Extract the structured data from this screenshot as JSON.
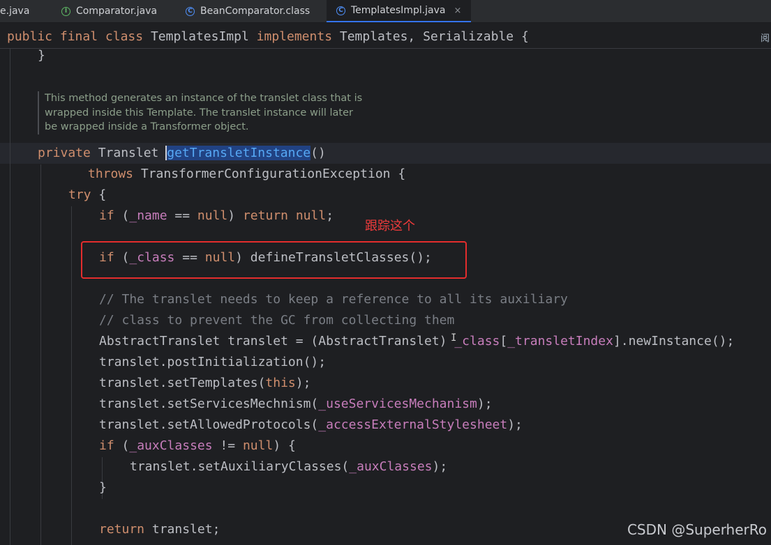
{
  "tabs": [
    {
      "label": "e.java",
      "icon": "none",
      "active": false
    },
    {
      "label": "Comparator.java",
      "icon": "interface-icon",
      "active": false
    },
    {
      "label": "BeanComparator.class",
      "icon": "class-icon",
      "active": false
    },
    {
      "label": "TemplatesImpl.java",
      "icon": "class-icon",
      "active": true,
      "close": "×"
    }
  ],
  "sticky_header": {
    "kw1": "public",
    "kw2": "final",
    "kw3": "class",
    "name": "TemplatesImpl ",
    "kw4": "implements",
    "rest": " Templates, Serializable {",
    "right_glyph": "阅"
  },
  "doc_comment": [
    "This method generates an instance of the translet class that is",
    "wrapped inside this Template. The translet instance will later",
    "be wrapped inside a Transformer object."
  ],
  "code": {
    "closing_brace": "}",
    "l_private": "private",
    "l_translet": " Translet ",
    "l_method": "getTransletInstance",
    "l_parens": "()",
    "l_throws": "throws",
    "l_exception": " TransformerConfigurationException {",
    "l_try": "try",
    "l_try_brace": " {",
    "if1_kw": "if",
    "if1_a": " (",
    "if1_field": "_name",
    "if1_b": " == ",
    "if1_null": "null",
    "if1_c": ") ",
    "if1_return": "return",
    "if1_d": " ",
    "if1_null2": "null",
    "if1_e": ";",
    "if2_kw": "if",
    "if2_a": " (",
    "if2_field": "_class",
    "if2_b": " == ",
    "if2_null": "null",
    "if2_c": ") defineTransletClasses();",
    "comment1": "// The translet needs to keep a reference to all its auxiliary",
    "comment2": "// class to prevent the GC from collecting them",
    "l10_a": "AbstractTranslet translet = (AbstractTranslet) ",
    "l10_f1": "_class",
    "l10_b": "[",
    "l10_f2": "_transletIndex",
    "l10_c": "].newInstance();",
    "l11": "translet.postInitialization();",
    "l12_a": "translet.setTemplates(",
    "l12_kw": "this",
    "l12_b": ");",
    "l13_a": "translet.setServicesMechnism(",
    "l13_f": "_useServicesMechanism",
    "l13_b": ");",
    "l14_a": "translet.setAllowedProtocols(",
    "l14_f": "_accessExternalStylesheet",
    "l14_b": ");",
    "l15_kw": "if",
    "l15_a": " (",
    "l15_f": "_auxClasses",
    "l15_b": " != ",
    "l15_null": "null",
    "l15_c": ") {",
    "l16_a": "translet.setAuxiliaryClasses(",
    "l16_f": "_auxClasses",
    "l16_b": ");",
    "l17": "}",
    "l18_kw": "return",
    "l18_a": " translet;"
  },
  "annotation": {
    "note": "跟踪这个"
  },
  "watermark": "CSDN @SuperherRo",
  "colors": {
    "background": "#1e1f22",
    "keyword": "#cf8e6d",
    "field": "#c77dbb",
    "comment": "#7a7e85",
    "method": "#56a8f5",
    "annotation_red": "#e42d2d"
  }
}
